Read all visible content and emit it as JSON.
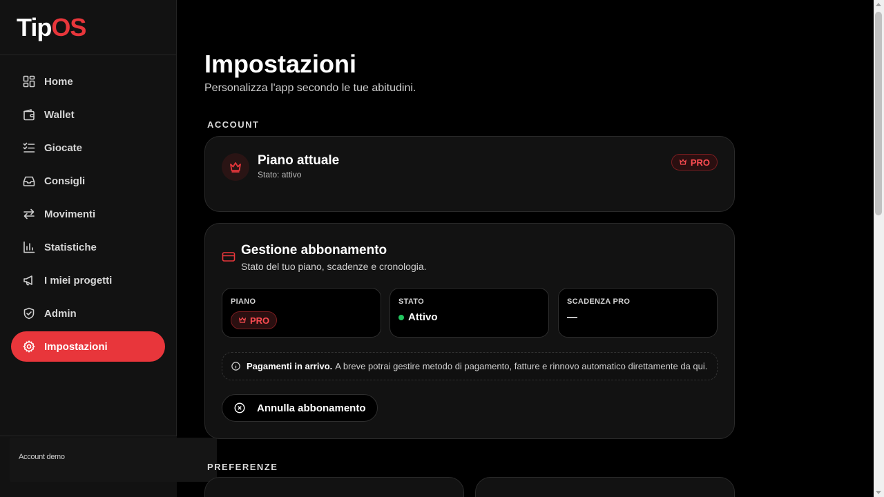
{
  "logo": {
    "part1": "Tip",
    "part2": "OS"
  },
  "sidebar": {
    "items": [
      {
        "label": "Home",
        "icon": "dashboard-icon"
      },
      {
        "label": "Wallet",
        "icon": "wallet-icon"
      },
      {
        "label": "Giocate",
        "icon": "checklist-icon"
      },
      {
        "label": "Consigli",
        "icon": "inbox-icon"
      },
      {
        "label": "Movimenti",
        "icon": "arrows-swap-icon"
      },
      {
        "label": "Statistiche",
        "icon": "bar-chart-icon"
      },
      {
        "label": "I miei progetti",
        "icon": "megaphone-icon"
      },
      {
        "label": "Admin",
        "icon": "shield-check-icon"
      },
      {
        "label": "Impostazioni",
        "icon": "gear-icon",
        "active": true
      }
    ],
    "account_label": "Account demo"
  },
  "page": {
    "title": "Impostazioni",
    "subtitle": "Personalizza l'app secondo le tue abitudini."
  },
  "sections": {
    "account": "ACCOUNT",
    "preferences": "PREFERENZE"
  },
  "plan_card": {
    "title": "Piano attuale",
    "status": "Stato: attivo",
    "badge": "PRO"
  },
  "subscription": {
    "title": "Gestione abbonamento",
    "description": "Stato del tuo piano, scadenze e cronologia.",
    "tiles": {
      "plan": {
        "label": "PIANO",
        "value": "PRO"
      },
      "status": {
        "label": "STATO",
        "value": "Attivo"
      },
      "expiry": {
        "label": "SCADENZA PRO",
        "value": "—"
      }
    },
    "info_bold": "Pagamenti in arrivo.",
    "info_text": "A breve potrai gestire metodo di pagamento, fatture e rinnovo automatico direttamente da qui.",
    "cancel_label": "Annulla abbonamento"
  },
  "colors": {
    "accent": "#e8363b",
    "background": "#000000",
    "sidebar": "#121212",
    "card": "#121212",
    "status_ok": "#22c55e"
  }
}
